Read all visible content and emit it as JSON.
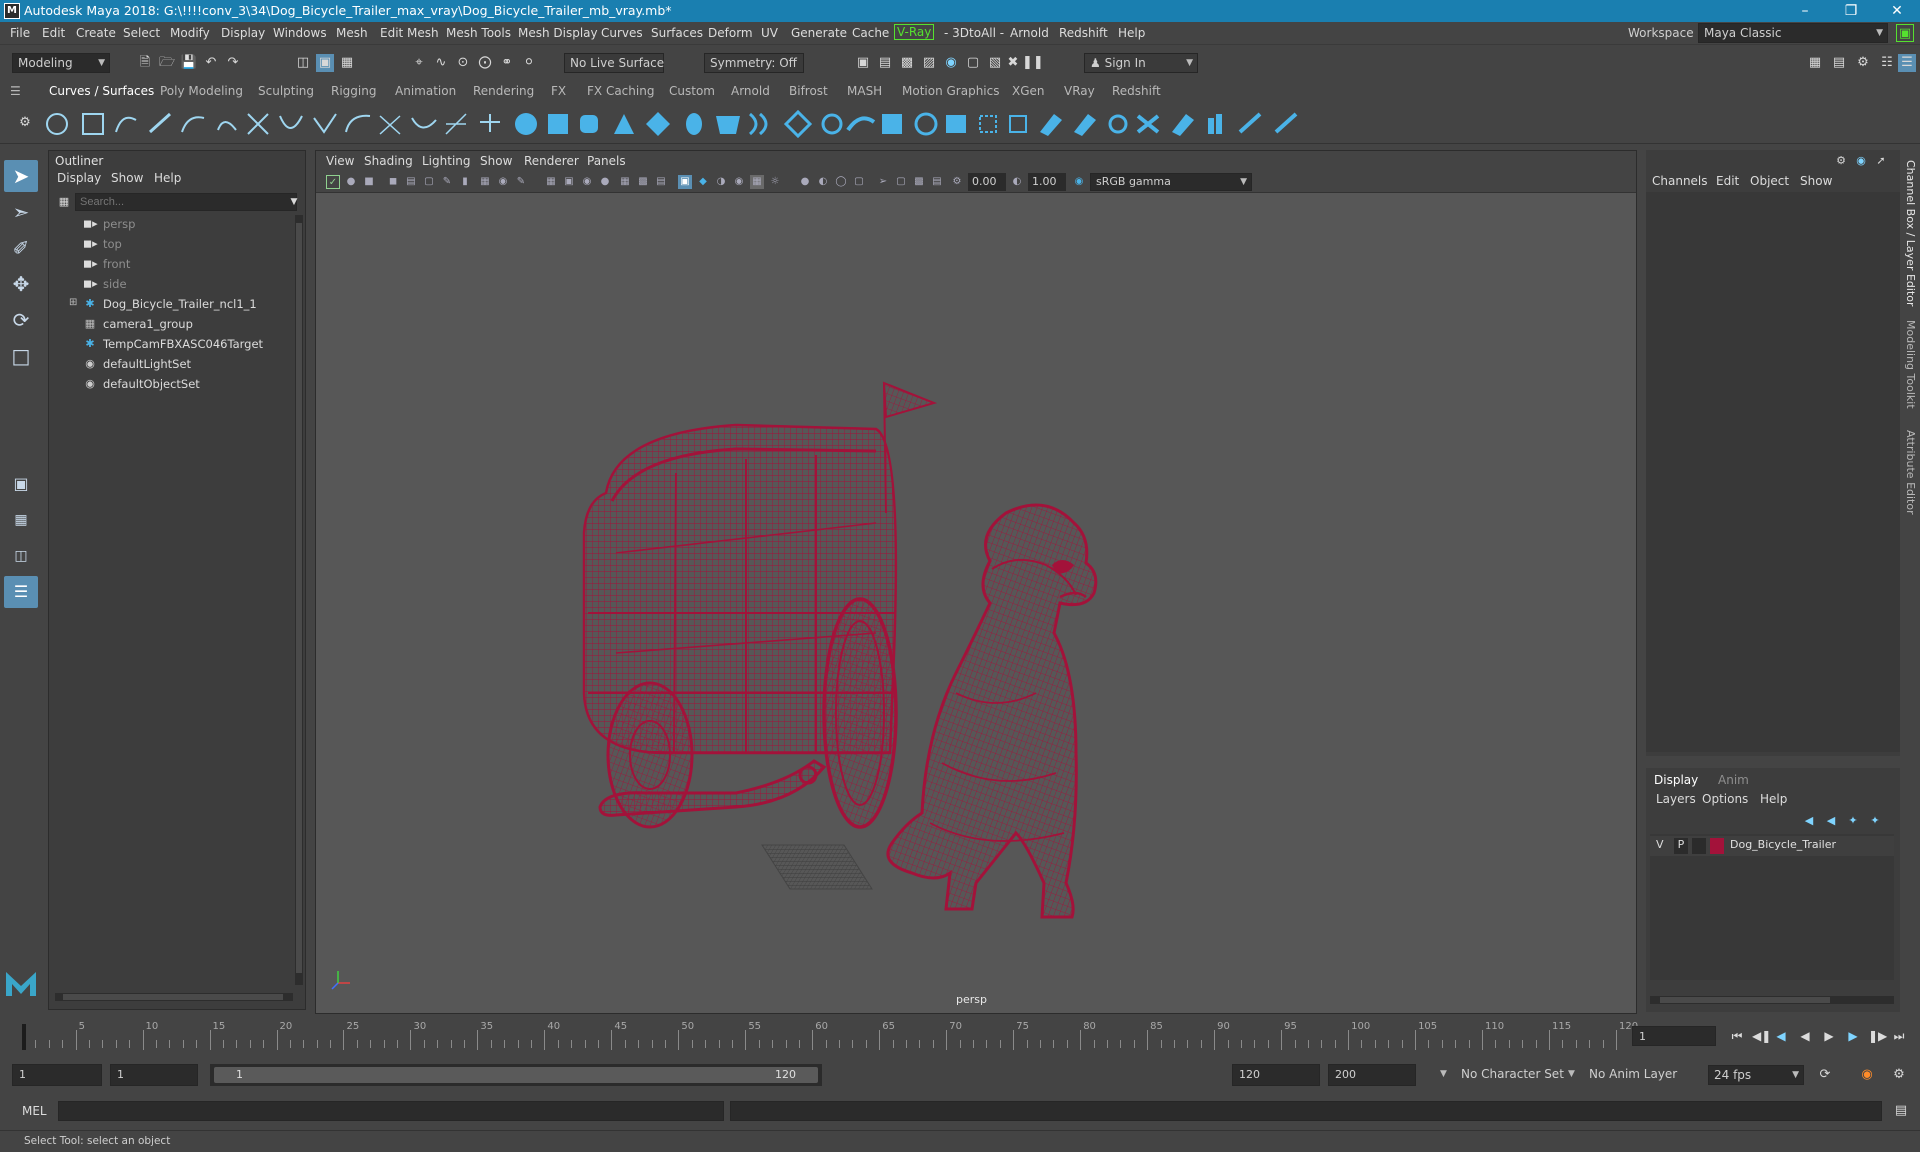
{
  "window": {
    "title": "Autodesk Maya 2018: G:\\!!!!conv_3\\34\\Dog_Bicycle_Trailer_max_vray\\Dog_Bicycle_Trailer_mb_vray.mb*",
    "logo": "M",
    "controls": [
      "minimize-icon",
      "restore-icon",
      "close-icon"
    ]
  },
  "menus": [
    "File",
    "Edit",
    "Create",
    "Select",
    "Modify",
    "Display",
    "Windows",
    "Mesh",
    "Edit Mesh",
    "Mesh Tools",
    "Mesh Display",
    "Curves",
    "Surfaces",
    "Deform",
    "UV",
    "Generate",
    "Cache",
    "V-Ray",
    "- 3DtoAll -",
    "Arnold",
    "Redshift",
    "Help"
  ],
  "workspace": {
    "label": "Workspace :",
    "value": "Maya Classic"
  },
  "statusline": {
    "mode": "Modeling",
    "live_surface": "No Live Surface",
    "symmetry": "Symmetry: Off",
    "sign_in": "Sign In"
  },
  "shelf_tabs": [
    "Curves / Surfaces",
    "Poly Modeling",
    "Sculpting",
    "Rigging",
    "Animation",
    "Rendering",
    "FX",
    "FX Caching",
    "Custom",
    "Arnold",
    "Bifrost",
    "MASH",
    "Motion Graphics",
    "XGen",
    "VRay",
    "Redshift"
  ],
  "shelf_active_tab": "Curves / Surfaces",
  "outliner": {
    "title": "Outliner",
    "menus": [
      "Display",
      "Show",
      "Help"
    ],
    "search_placeholder": "Search...",
    "items": [
      {
        "label": "persp",
        "icon": "camera-icon",
        "dim": true
      },
      {
        "label": "top",
        "icon": "camera-icon",
        "dim": true
      },
      {
        "label": "front",
        "icon": "camera-icon",
        "dim": true
      },
      {
        "label": "side",
        "icon": "camera-icon",
        "dim": true
      },
      {
        "label": "Dog_Bicycle_Trailer_ncl1_1",
        "icon": "transform-icon",
        "dim": false,
        "expandable": true
      },
      {
        "label": "camera1_group",
        "icon": "group-icon",
        "dim": false
      },
      {
        "label": "TempCamFBXASC046Target",
        "icon": "transform-icon",
        "dim": false
      },
      {
        "label": "defaultLightSet",
        "icon": "set-icon",
        "dim": false
      },
      {
        "label": "defaultObjectSet",
        "icon": "set-icon",
        "dim": false
      }
    ]
  },
  "viewport": {
    "menus": [
      "View",
      "Shading",
      "Lighting",
      "Show",
      "Renderer",
      "Panels"
    ],
    "exposure": "0.00",
    "gamma": "1.00",
    "color_space": "sRGB gamma",
    "camera_label": "persp",
    "wire_color": "#a3123a",
    "bg_color": "#575757"
  },
  "channel_box": {
    "menus": [
      "Channels",
      "Edit",
      "Object",
      "Show"
    ]
  },
  "layer_editor": {
    "tabs": [
      "Display",
      "Anim"
    ],
    "menus": [
      "Layers",
      "Options",
      "Help"
    ],
    "layer": {
      "v": "V",
      "p": "P",
      "name": "Dog_Bicycle_Trailer",
      "color": "#a3123a"
    }
  },
  "side_tabs": [
    "Channel Box / Layer Editor",
    "Modeling Toolkit",
    "Attribute Editor"
  ],
  "timeline": {
    "ticks": [
      5,
      10,
      15,
      20,
      25,
      30,
      35,
      40,
      45,
      50,
      55,
      60,
      65,
      70,
      75,
      80,
      85,
      90,
      95,
      100,
      105,
      110,
      115,
      120
    ],
    "current_frame": "1",
    "range_min": 1,
    "range_max": 120
  },
  "range": {
    "start": "1",
    "start_inner": "1",
    "slider_start": "1",
    "slider_end": "120",
    "end_inner": "120",
    "end": "200",
    "character_set": "No Character Set",
    "anim_layer": "No Anim Layer",
    "fps": "24 fps"
  },
  "command_line": {
    "label": "MEL"
  },
  "help_line": "Select Tool: select an object"
}
